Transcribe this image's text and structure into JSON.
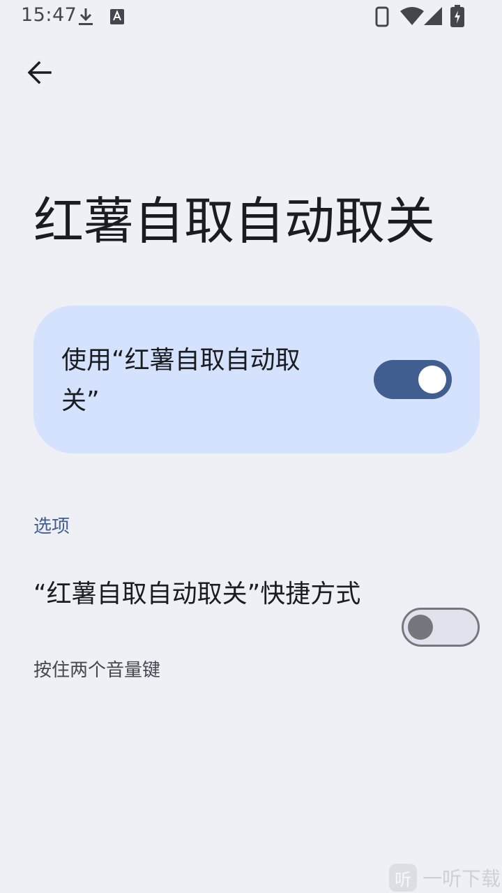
{
  "status_bar": {
    "time": "15:47",
    "icons": [
      "download-icon",
      "a-notification-icon",
      "phone-icon",
      "wifi-icon",
      "cell-signal-icon",
      "battery-charging-icon"
    ]
  },
  "header": {
    "back_icon": "arrow-back-icon",
    "title": "红薯自取自动取关"
  },
  "main_toggle": {
    "label": "使用“红薯自取自动取关”",
    "state": "on",
    "color_on": "#405e90",
    "card_color": "#d5e2fd"
  },
  "options_section": {
    "header": "选项",
    "shortcut": {
      "title": "“红薯自取自动取关”快捷方式",
      "subtitle": "按住两个音量键",
      "state": "off"
    }
  },
  "watermark": {
    "logo": "听",
    "text": "一听下载"
  }
}
